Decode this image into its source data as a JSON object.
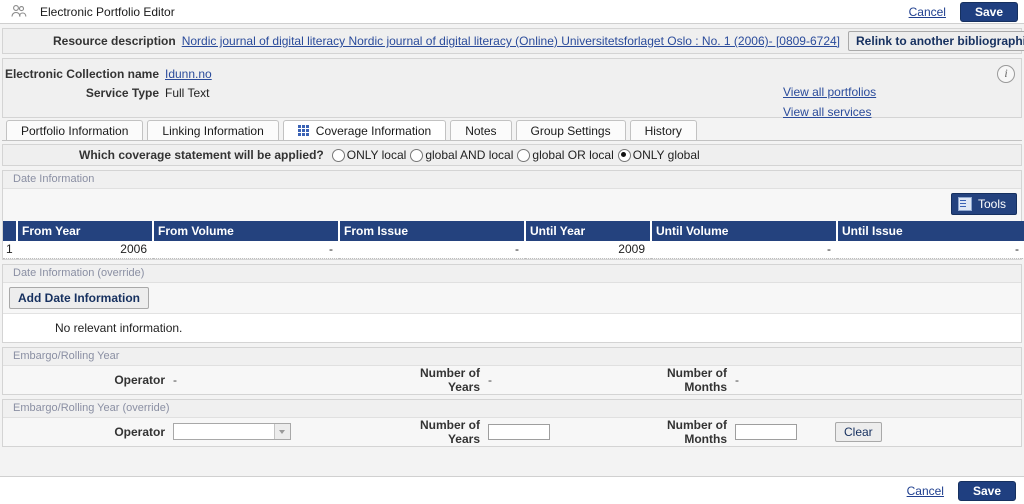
{
  "window": {
    "title": "Electronic Portfolio Editor",
    "icon": "people-group-icon",
    "cancel_label": "Cancel",
    "save_label": "Save"
  },
  "resource": {
    "label": "Resource description",
    "value": "Nordic journal of digital literacy Nordic journal of digital literacy (Online) Universitetsforlaget Oslo : No. 1 (2006)- [0809-6724]",
    "relink_label": "Relink to another bibliographic record"
  },
  "info_panel": {
    "collection_label": "Electronic Collection name",
    "collection_value": "Idunn.no",
    "service_label": "Service Type",
    "service_value": "Full Text",
    "view_all_portfolios": "View all portfolios",
    "view_all_services": "View all services",
    "info_icon": "info-icon"
  },
  "tabs": [
    {
      "label": "Portfolio Information",
      "active": false,
      "icon": ""
    },
    {
      "label": "Linking Information",
      "active": false,
      "icon": ""
    },
    {
      "label": "Coverage Information",
      "active": true,
      "icon": "grid-icon"
    },
    {
      "label": "Notes",
      "active": false,
      "icon": ""
    },
    {
      "label": "Group Settings",
      "active": false,
      "icon": ""
    },
    {
      "label": "History",
      "active": false,
      "icon": ""
    }
  ],
  "coverage_question": {
    "question": "Which coverage statement will be applied?",
    "options": [
      {
        "label": "ONLY local",
        "selected": false
      },
      {
        "label": "global AND local",
        "selected": false
      },
      {
        "label": "global OR local",
        "selected": false
      },
      {
        "label": "ONLY global",
        "selected": true
      }
    ]
  },
  "date_information": {
    "section_title": "Date Information",
    "tools_label": "Tools",
    "tools_icon": "tools-icon",
    "columns": [
      "",
      "From Year",
      "From Volume",
      "From Issue",
      "Until Year",
      "Until Volume",
      "Until Issue"
    ],
    "rows": [
      {
        "index": "1",
        "from_year": "2006",
        "from_volume": "-",
        "from_issue": "-",
        "until_year": "2009",
        "until_volume": "-",
        "until_issue": "-"
      }
    ]
  },
  "date_information_override": {
    "section_title": "Date Information (override)",
    "add_button_label": "Add Date Information",
    "empty_message": "No relevant information."
  },
  "embargo": {
    "section_title": "Embargo/Rolling Year",
    "operator_label": "Operator",
    "operator_value": "-",
    "years_label": "Number of Years",
    "years_value": "-",
    "months_label": "Number of Months",
    "months_value": "-"
  },
  "embargo_override": {
    "section_title": "Embargo/Rolling Year (override)",
    "operator_label": "Operator",
    "operator_value": "",
    "operator_placeholder": "",
    "years_label": "Number of Years",
    "years_value": "",
    "months_label": "Number of Months",
    "months_value": "",
    "clear_label": "Clear"
  },
  "footer": {
    "cancel_label": "Cancel",
    "save_label": "Save"
  },
  "colors": {
    "accent": "#24427e",
    "link": "#2a4b9b",
    "header_bg": "#24427e",
    "panel_bg": "#f0f0f0"
  }
}
